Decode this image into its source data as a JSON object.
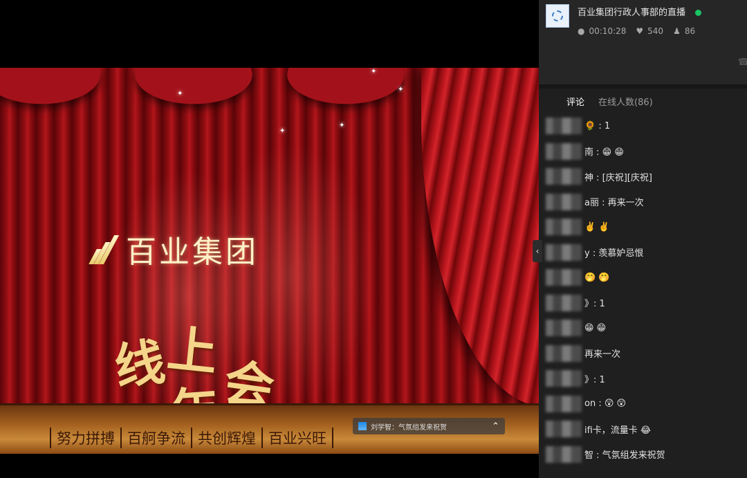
{
  "video": {
    "company_name": "百业集团",
    "event_title_chars": [
      "线",
      "上",
      "年",
      "会"
    ],
    "slogans": [
      "努力拼搏",
      "百舸争流",
      "共创辉煌",
      "百业兴旺"
    ],
    "danmaku_text": "刘学智：气氛组发来祝贺"
  },
  "panel": {
    "channel_name": "百业集团行政人事部的直播",
    "stats": {
      "duration": "00:10:28",
      "likes": "540",
      "viewers": "86"
    },
    "tabs": {
      "comments": "评论",
      "online": "在线人数(86)"
    },
    "comments": [
      {
        "tail": "🌻 : 1"
      },
      {
        "tail": "南 : 😁 😁"
      },
      {
        "tail": "神 : [庆祝][庆祝]"
      },
      {
        "tail": "a丽 : 再来一次"
      },
      {
        "tail": "✌️ ✌️"
      },
      {
        "tail": "y : 羡慕妒忌恨"
      },
      {
        "tail": "🤭 🤭"
      },
      {
        "tail": "》: 1"
      },
      {
        "tail": "😁 😁"
      },
      {
        "tail": "再来一次"
      },
      {
        "tail": "》: 1"
      },
      {
        "tail": "on : 😲 😲"
      },
      {
        "tail": "ifi卡，流量卡 😂"
      },
      {
        "tail": "智 : 气氛组发来祝贺"
      }
    ]
  },
  "colors": {
    "live": "#19c464",
    "panel_bg": "#1f1f1f",
    "curtain": "#a3121a"
  },
  "icons": {
    "duration": "clock-icon",
    "likes": "heart-icon",
    "viewers": "user-icon",
    "collapse": "chevron-left-icon",
    "danmaku_toggle": "chevron-up-icon"
  }
}
